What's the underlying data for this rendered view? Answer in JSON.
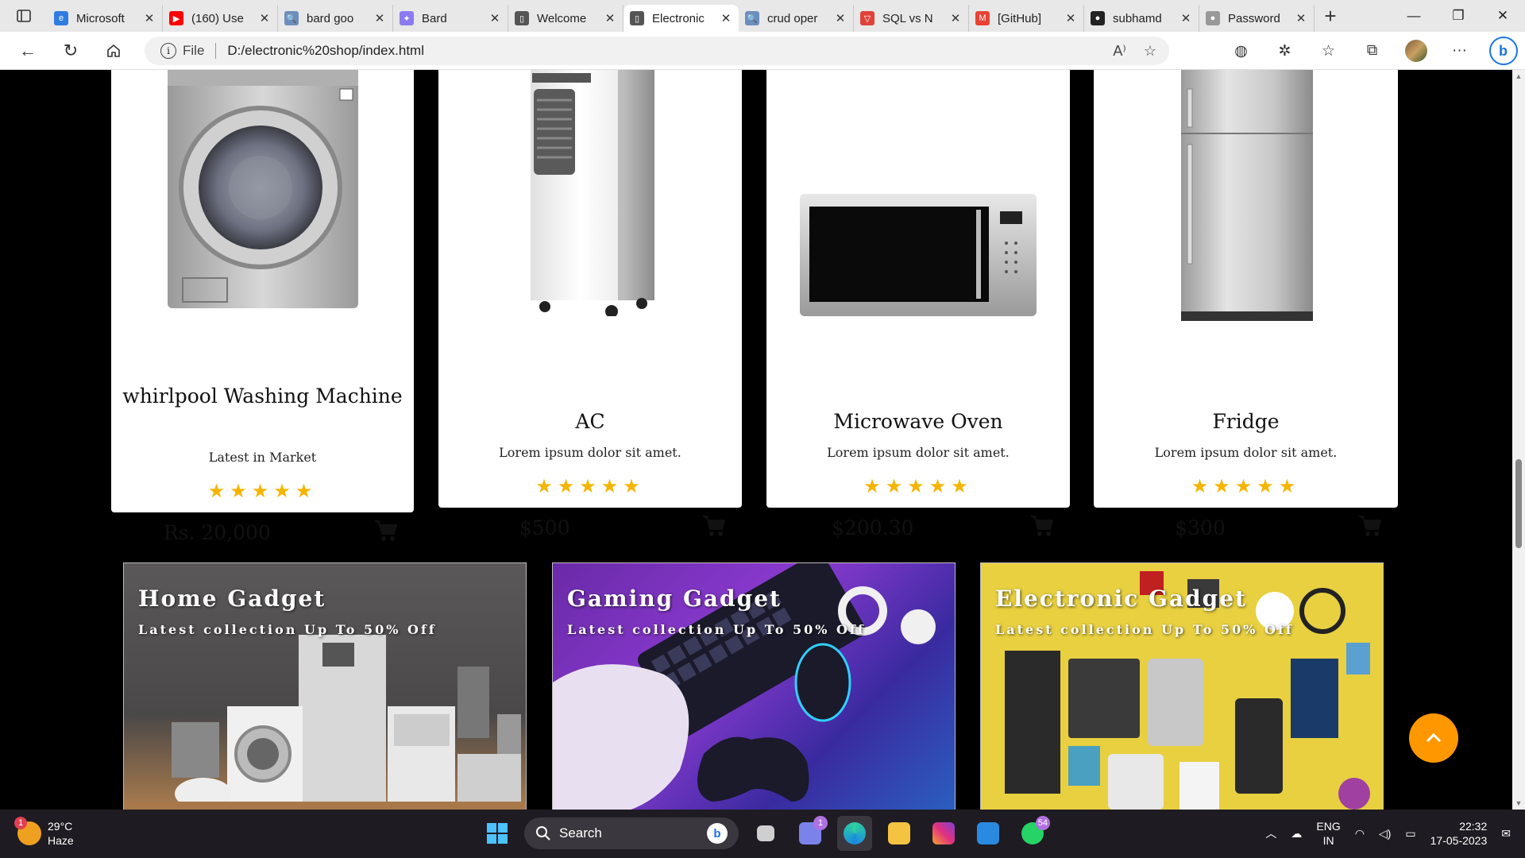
{
  "browser": {
    "tabs": [
      {
        "label": "Microsoft",
        "color": "#2f7de1",
        "glyph": "e"
      },
      {
        "label": "(160) Use",
        "color": "#ff0000",
        "glyph": "▶"
      },
      {
        "label": "bard goo",
        "color": "#6c8ebf",
        "glyph": "🔍"
      },
      {
        "label": "Bard",
        "color": "#8a7cf0",
        "glyph": "✦"
      },
      {
        "label": "Welcome",
        "color": "#555555",
        "glyph": "▯"
      },
      {
        "label": "Electronic",
        "color": "#555555",
        "glyph": "▯",
        "active": true
      },
      {
        "label": "crud oper",
        "color": "#6c8ebf",
        "glyph": "🔍"
      },
      {
        "label": "SQL vs N",
        "color": "#e0423a",
        "glyph": "▽"
      },
      {
        "label": "[GitHub]",
        "color": "#ea4335",
        "glyph": "M"
      },
      {
        "label": "subhamd",
        "color": "#222222",
        "glyph": "●"
      },
      {
        "label": "Password",
        "color": "#999999",
        "glyph": "●"
      }
    ],
    "address": {
      "info_glyph": "i",
      "file_label": "File",
      "url": "D:/electronic%20shop/index.html"
    }
  },
  "products": [
    {
      "name": "whirlpool Washing Machine",
      "desc": "Latest in Market",
      "stars": "★★★★★",
      "price": "Rs. 20,000",
      "image": "washing-machine"
    },
    {
      "name": "AC",
      "desc": "Lorem ipsum dolor sit amet.",
      "stars": "★★★★★",
      "price": "$500",
      "image": "air-cooler"
    },
    {
      "name": "Microwave Oven",
      "desc": "Lorem ipsum dolor sit amet.",
      "stars": "★★★★★",
      "price": "$200.30",
      "image": "microwave"
    },
    {
      "name": "Fridge",
      "desc": "Lorem ipsum dolor sit amet.",
      "stars": "★★★★★",
      "price": "$300",
      "image": "fridge"
    }
  ],
  "banners": [
    {
      "title": "Home Gadget",
      "subtitle": "Latest collection Up To 50% Off"
    },
    {
      "title": "Gaming Gadget",
      "subtitle": "Latest collection Up To 50% Off"
    },
    {
      "title": "Electronic Gadget",
      "subtitle": "Latest collection Up To 50% Off"
    }
  ],
  "colors": {
    "accent_orange": "#ff9800",
    "star_yellow": "#f5b400",
    "page_background": "#000000"
  },
  "taskbar": {
    "weather": {
      "temp": "29°C",
      "condition": "Haze",
      "badge": "1"
    },
    "search_label": "Search",
    "teams_badge": "1",
    "whatsapp_badge": "54",
    "lang_line1": "ENG",
    "lang_line2": "IN",
    "time": "22:32",
    "date": "17-05-2023"
  }
}
